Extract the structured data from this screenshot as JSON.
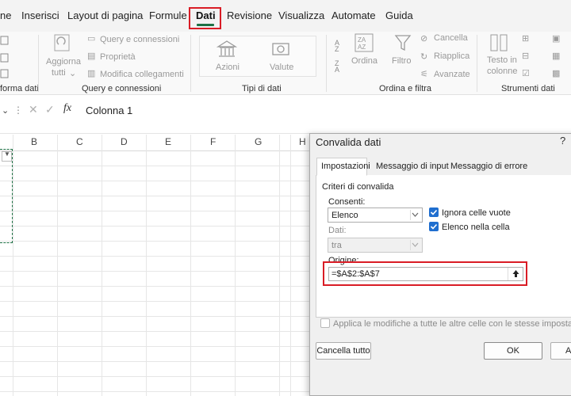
{
  "menu": {
    "tabs": [
      "ne",
      "Inserisci",
      "Layout di pagina",
      "Formule",
      "Dati",
      "Revisione",
      "Visualizza",
      "Automate",
      "Guida"
    ],
    "active": "Dati"
  },
  "ribbon": {
    "get_transform": {
      "group_label": "forma dati"
    },
    "queries": {
      "group_label": "Query e connessioni",
      "refresh_all_line1": "Aggiorna",
      "refresh_all_line2": "tutti",
      "items": [
        "Query e connessioni",
        "Proprietà",
        "Modifica collegamenti"
      ]
    },
    "data_types": {
      "group_label": "Tipi di dati",
      "stocks": "Azioni",
      "currencies": "Valute"
    },
    "sort_filter": {
      "group_label": "Ordina e filtra",
      "sort": "Ordina",
      "filter": "Filtro",
      "clear": "Cancella",
      "reapply": "Riapplica",
      "advanced": "Avanzate"
    },
    "data_tools": {
      "group_label": "Strumenti dati",
      "text_to_columns_line1": "Testo in",
      "text_to_columns_line2": "colonne"
    }
  },
  "formula_bar": {
    "fx": "fx",
    "content": "Colonna 1"
  },
  "grid": {
    "columns": [
      "B",
      "C",
      "D",
      "E",
      "F",
      "G",
      "H"
    ]
  },
  "dialog": {
    "title": "Convalida dati",
    "help": "?",
    "tabs": [
      "Impostazioni",
      "Messaggio di input",
      "Messaggio di errore"
    ],
    "section": "Criteri di convalida",
    "allow_label": "Consenti:",
    "allow_value": "Elenco",
    "ignore_blank": "Ignora celle vuote",
    "in_cell_dropdown": "Elenco nella cella",
    "data_label": "Dati:",
    "data_value": "tra",
    "source_label": "Origine:",
    "source_value": "=$A$2:$A$7",
    "apply_all": "Applica le modifiche a tutte le altre celle con le stesse impostazioni",
    "clear_all": "Cancella tutto",
    "ok": "OK",
    "cancel_partial": "A"
  },
  "colors": {
    "accent": "#1e7145",
    "highlight": "#d91c25",
    "checkbox": "#1f6ecf"
  }
}
